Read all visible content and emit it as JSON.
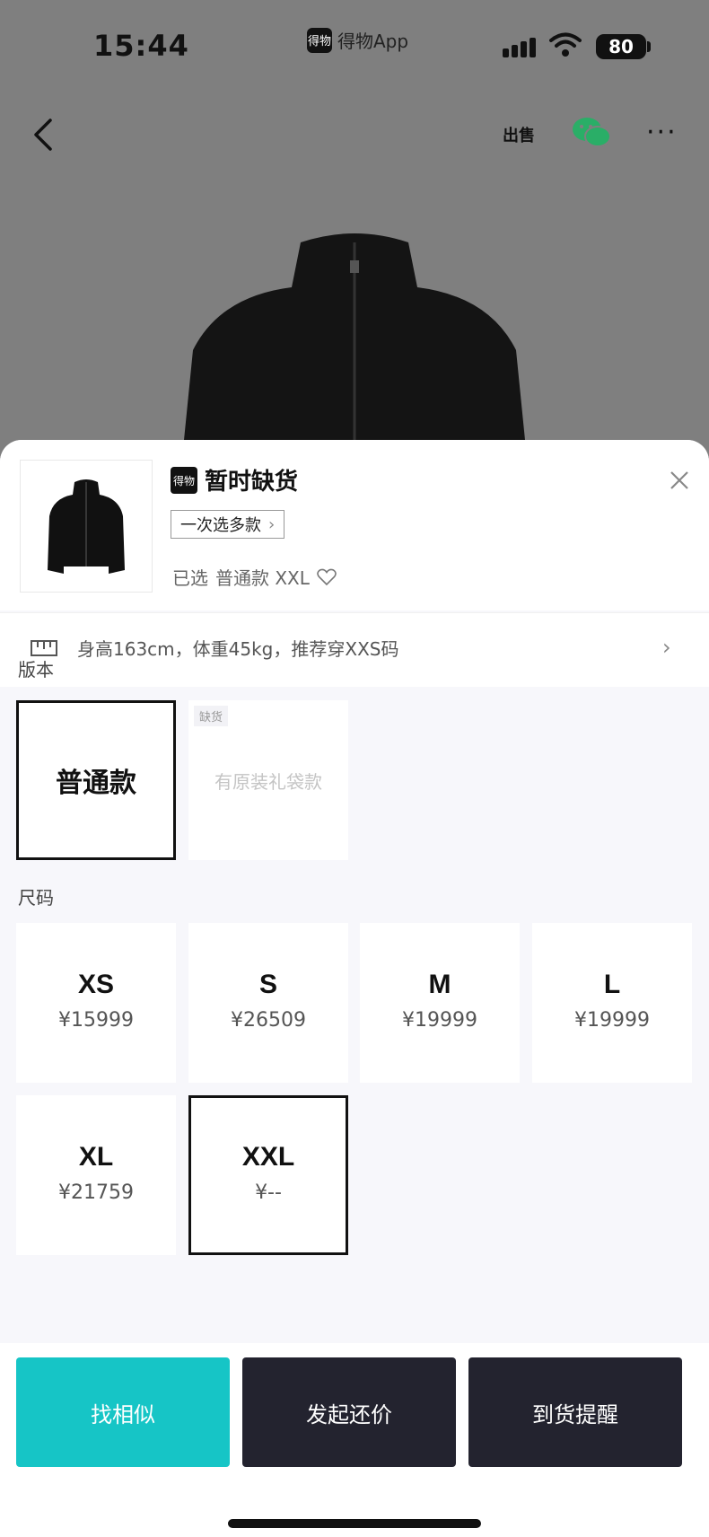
{
  "status_bar": {
    "time": "15:44",
    "app_name": "得物App",
    "app_logo": "得物",
    "battery": "80"
  },
  "nav": {
    "sell_label": "出售",
    "more_label": "···"
  },
  "sheet": {
    "logo": "得物",
    "title": "暂时缺货",
    "multi_select_label": "一次选多款",
    "selected_prefix": "已选",
    "selected_value": "普通款 XXL",
    "recommendation": "身高163cm，体重45kg，推荐穿XXS码",
    "version_label": "版本",
    "versions": [
      {
        "name": "普通款",
        "selected": true
      },
      {
        "name": "有原装礼袋款",
        "badge": "缺货"
      }
    ],
    "size_label": "尺码",
    "sizes": [
      {
        "name": "XS",
        "price": "¥15999"
      },
      {
        "name": "S",
        "price": "¥26509"
      },
      {
        "name": "M",
        "price": "¥19999"
      },
      {
        "name": "L",
        "price": "¥19999"
      },
      {
        "name": "XL",
        "price": "¥21759"
      },
      {
        "name": "XXL",
        "price": "¥--",
        "selected": true
      }
    ]
  },
  "actions": {
    "find_similar": "找相似",
    "counter_offer": "发起还价",
    "restock_alert": "到货提醒"
  },
  "colors": {
    "accent_teal": "#16c5c6",
    "dark_button": "#23232f"
  }
}
